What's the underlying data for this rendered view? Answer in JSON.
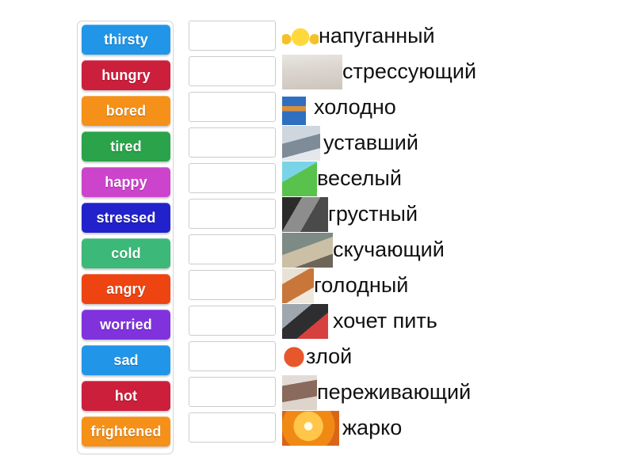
{
  "exercise": {
    "type": "match-up",
    "word_tiles": [
      {
        "label": "thirsty",
        "color": "#2196e8"
      },
      {
        "label": "hungry",
        "color": "#cc1f3c"
      },
      {
        "label": "bored",
        "color": "#f59018"
      },
      {
        "label": "tired",
        "color": "#2aa34a"
      },
      {
        "label": "happy",
        "color": "#cc44cc"
      },
      {
        "label": "stressed",
        "color": "#2222cc"
      },
      {
        "label": "cold",
        "color": "#3cb878"
      },
      {
        "label": "angry",
        "color": "#ee4411"
      },
      {
        "label": "worried",
        "color": "#8033dd"
      },
      {
        "label": "sad",
        "color": "#2196e8"
      },
      {
        "label": "hot",
        "color": "#cc1f3c"
      },
      {
        "label": "frightened",
        "color": "#f59018"
      }
    ],
    "drop_boxes": [
      {
        "value": ""
      },
      {
        "value": ""
      },
      {
        "value": ""
      },
      {
        "value": ""
      },
      {
        "value": ""
      },
      {
        "value": ""
      },
      {
        "value": ""
      },
      {
        "value": ""
      },
      {
        "value": ""
      },
      {
        "value": ""
      },
      {
        "value": ""
      },
      {
        "value": ""
      }
    ],
    "answer_rows": [
      {
        "text": "напуганный",
        "icon": "scared-face-emoji-image"
      },
      {
        "text": "стрессующий",
        "icon": "stressed-woman-photo"
      },
      {
        "text": "холодно",
        "icon": "boy-in-winter-clothes-cartoon"
      },
      {
        "text": "уставший",
        "icon": "tired-man-at-desk-photo"
      },
      {
        "text": "веселый",
        "icon": "happy-child-drawing"
      },
      {
        "text": "грустный",
        "icon": "sad-person-blackwhite-photo"
      },
      {
        "text": "скучающий",
        "icon": "bored-person-photo"
      },
      {
        "text": "голодный",
        "icon": "hungry-cat-photo"
      },
      {
        "text": "хочет пить",
        "icon": "man-drinking-water-photo"
      },
      {
        "text": "злой",
        "icon": "angry-face-emoji-image"
      },
      {
        "text": "переживающий",
        "icon": "worried-woman-photo"
      },
      {
        "text": "жарко",
        "icon": "hot-sun-thermometer-photo"
      }
    ]
  }
}
